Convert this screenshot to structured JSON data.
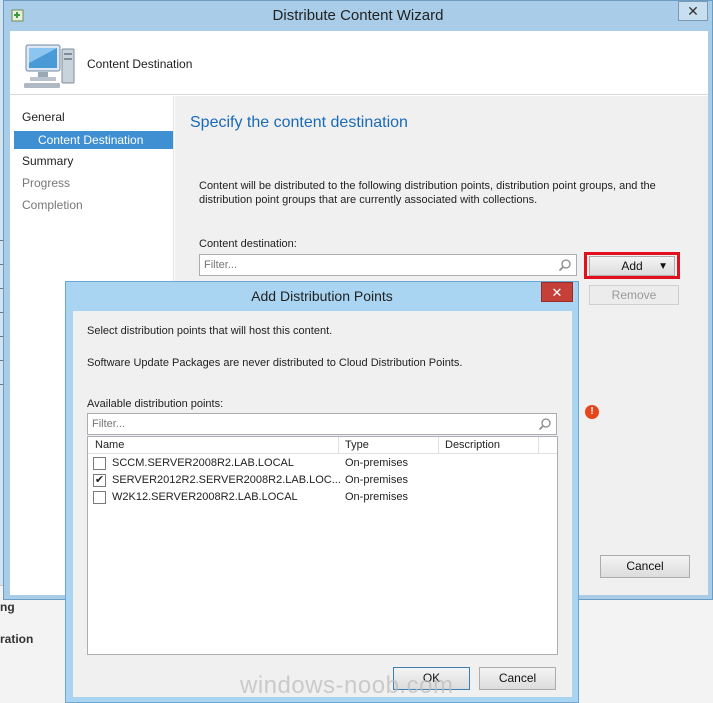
{
  "background": {
    "console_text_1": "ng",
    "console_text_2": "ration"
  },
  "wizard": {
    "title": "Distribute Content Wizard",
    "close_glyph": "✕",
    "header_title": "Content Destination",
    "nav": [
      {
        "label": "General",
        "state": "normal"
      },
      {
        "label": "Content Destination",
        "state": "active"
      },
      {
        "label": "Summary",
        "state": "normal"
      },
      {
        "label": "Progress",
        "state": "dim"
      },
      {
        "label": "Completion",
        "state": "dim"
      }
    ],
    "heading": "Specify the content destination",
    "description": "Content will be distributed to the following distribution points, distribution point groups, and the distribution point groups that are currently associated with collections.",
    "destination_label": "Content destination:",
    "filter_placeholder": "Filter...",
    "add_label": "Add",
    "remove_label": "Remove",
    "cancel_label": "Cancel",
    "error_glyph": "!"
  },
  "dialog": {
    "title": "Add Distribution Points",
    "close_glyph": "✕",
    "instruction": "Select distribution points that will host this content.",
    "note": "Software Update Packages are never distributed to Cloud Distribution Points.",
    "available_label": "Available distribution points:",
    "filter_placeholder": "Filter...",
    "columns": [
      "Name",
      "Type",
      "Description"
    ],
    "rows": [
      {
        "name": "SCCM.SERVER2008R2.LAB.LOCAL",
        "type": "On-premises",
        "checked": false
      },
      {
        "name": "SERVER2012R2.SERVER2008R2.LAB.LOC...",
        "type": "On-premises",
        "checked": true
      },
      {
        "name": "W2K12.SERVER2008R2.LAB.LOCAL",
        "type": "On-premises",
        "checked": false
      }
    ],
    "ok_label": "OK",
    "cancel_label": "Cancel"
  },
  "watermark": "windows-noob.com",
  "colors": {
    "accent": "#3f8fd3",
    "heading": "#1a6ab8",
    "highlight_border": "#e2101e",
    "dialog_close": "#c6403a"
  }
}
